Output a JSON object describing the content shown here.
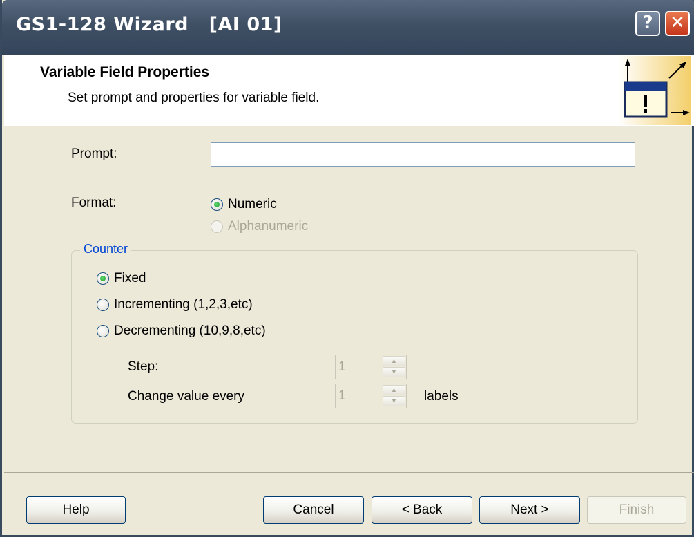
{
  "window": {
    "title": "GS1-128 Wizard   [AI 01]",
    "help_glyph": "?",
    "close_glyph": "✕"
  },
  "header": {
    "title": "Variable Field Properties",
    "subtitle": "Set prompt and properties for variable field.",
    "icon": "window-exclamation-icon"
  },
  "prompt": {
    "label": "Prompt:",
    "value": "",
    "placeholder": ""
  },
  "format": {
    "label": "Format:",
    "options": [
      {
        "label": "Numeric",
        "selected": true,
        "enabled": true
      },
      {
        "label": "Alphanumeric",
        "selected": false,
        "enabled": false
      }
    ]
  },
  "counter": {
    "legend": "Counter",
    "options": [
      {
        "label": "Fixed",
        "selected": true
      },
      {
        "label": "Incrementing (1,2,3,etc)",
        "selected": false
      },
      {
        "label": "Decrementing (10,9,8,etc)",
        "selected": false
      }
    ],
    "step": {
      "label": "Step:",
      "value": "1",
      "enabled": false
    },
    "change_every": {
      "label": "Change value every",
      "value": "1",
      "suffix": "labels",
      "enabled": false
    }
  },
  "buttons": {
    "help": "Help",
    "cancel": "Cancel",
    "back": "< Back",
    "next": "Next >",
    "finish": "Finish",
    "finish_enabled": false
  },
  "colors": {
    "titlebar": "#3f4f64",
    "dialog_bg": "#ece9d8",
    "group_legend": "#0046d5",
    "radio_selected": "#21a133",
    "close_button": "#c4361a"
  }
}
